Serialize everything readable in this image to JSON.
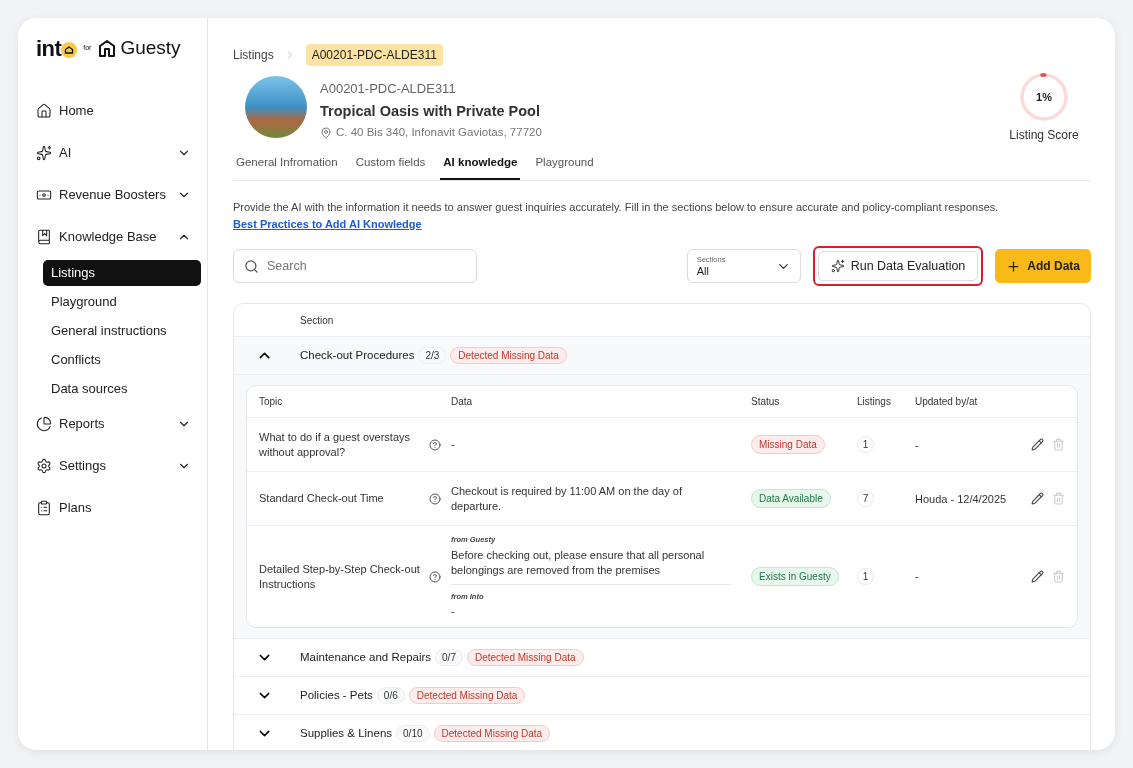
{
  "logo": {
    "brand": "int",
    "connector": "for",
    "partner": "Guesty"
  },
  "nav": [
    {
      "label": "Home"
    },
    {
      "label": "AI",
      "expanded": false
    },
    {
      "label": "Revenue Boosters",
      "expanded": false
    },
    {
      "label": "Knowledge Base",
      "expanded": true,
      "children": [
        {
          "label": "Listings",
          "selected": true
        },
        {
          "label": "Playground",
          "selected": false
        },
        {
          "label": "General instructions",
          "selected": false
        },
        {
          "label": "Conflicts",
          "selected": false
        },
        {
          "label": "Data sources",
          "selected": false
        }
      ]
    },
    {
      "label": "Reports",
      "expanded": false
    },
    {
      "label": "Settings",
      "expanded": false
    },
    {
      "label": "Plans"
    }
  ],
  "breadcrumb": [
    {
      "label": "Listings",
      "current": false
    },
    {
      "label": "A00201-PDC-ALDE311",
      "current": true
    }
  ],
  "listing": {
    "code": "A00201-PDC-ALDE311",
    "title": "Tropical Oasis with Private Pool",
    "address": "C. 40 Bis 340, Infonavit Gaviotas, 77720"
  },
  "score": {
    "value": "1%",
    "label": "Listing Score",
    "level": 0.01
  },
  "tabs": [
    {
      "label": "General Infromation",
      "selected": false
    },
    {
      "label": "Custom fields",
      "selected": false
    },
    {
      "label": "AI knowledge",
      "selected": true
    },
    {
      "label": "Playground",
      "selected": false
    }
  ],
  "intro": "Provide the AI with the information it needs to answer guest inquiries accurately. Fill in the sections below to ensure accurate and policy-compliant responses.",
  "intro_link": "Best Practices to Add AI Knowledge",
  "search": {
    "placeholder": "Search"
  },
  "sections_filter": {
    "label": "Sections",
    "value": "All"
  },
  "run_button": {
    "label": "Run Data Evaluation",
    "highlighted": true
  },
  "add_button": {
    "label": "Add Data"
  },
  "table_header": "Section",
  "sections": [
    {
      "name": "Check-out Procedures",
      "count": "2/3",
      "badge": "Detected Missing Data",
      "expanded": true,
      "columns": [
        "Topic",
        "Data",
        "Status",
        "Listings",
        "Updated by/at"
      ],
      "rows": [
        {
          "topic": "What to do if a guest overstays without approval?",
          "data": "-",
          "status": {
            "text": "Missing Data",
            "kind": "missing"
          },
          "listings": "1",
          "updated": "-"
        },
        {
          "topic": "Standard Check-out Time",
          "data": "Checkout is required by 11:00 AM on the day of departure.",
          "status": {
            "text": "Data Available",
            "kind": "available"
          },
          "listings": "7",
          "updated": "Houda - 12/4/2025"
        },
        {
          "topic": "Detailed Step-by-Step Check-out Instructions",
          "sources": [
            {
              "from": "from Guesty",
              "text": "Before checking out, please ensure that all personal belongings are removed from the premises"
            },
            {
              "from": "from Into",
              "text": "-"
            }
          ],
          "status": {
            "text": "Exists in Guesty",
            "kind": "available"
          },
          "listings": "1",
          "updated": "-"
        }
      ]
    },
    {
      "name": "Maintenance and Repairs",
      "count": "0/7",
      "badge": "Detected Missing Data",
      "expanded": false
    },
    {
      "name": "Policies - Pets",
      "count": "0/6",
      "badge": "Detected Missing Data",
      "expanded": false
    },
    {
      "name": "Supplies & Linens",
      "count": "0/10",
      "badge": "Detected Missing Data",
      "expanded": false
    }
  ]
}
